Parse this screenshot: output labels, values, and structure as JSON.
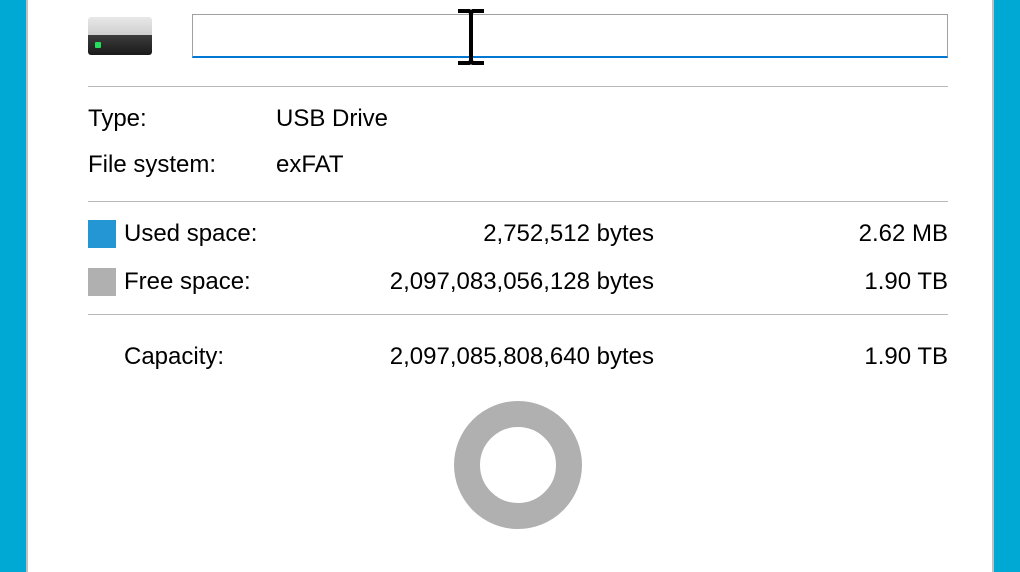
{
  "header": {
    "drive_name": ""
  },
  "info": {
    "type_label": "Type:",
    "type_value": "USB Drive",
    "fs_label": "File system:",
    "fs_value": "exFAT"
  },
  "space": {
    "used_label": "Used space:",
    "used_bytes": "2,752,512 bytes",
    "used_human": "2.62 MB",
    "free_label": "Free space:",
    "free_bytes": "2,097,083,056,128 bytes",
    "free_human": "1.90 TB"
  },
  "capacity": {
    "label": "Capacity:",
    "bytes": "2,097,085,808,640 bytes",
    "human": "1.90 TB"
  },
  "colors": {
    "used_swatch": "#2596d4",
    "free_swatch": "#b0b0b0",
    "accent": "#0078d4"
  }
}
